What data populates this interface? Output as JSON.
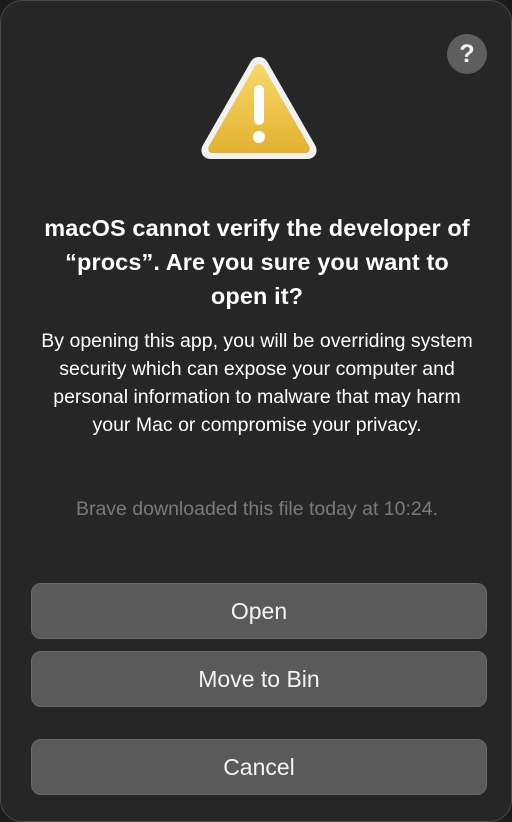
{
  "dialog": {
    "help_icon": "?",
    "warning_icon": "warning-triangle",
    "title": "macOS cannot verify the developer of “procs”. Are you sure you want to open it?",
    "message": "By opening this app, you will be overriding system security which can expose your computer and personal information to malware that may harm your Mac or compromise your privacy.",
    "download_info": "Brave downloaded this file today at 10:24.",
    "buttons": {
      "open": "Open",
      "move_to_bin": "Move to Bin",
      "cancel": "Cancel"
    },
    "colors": {
      "background": "#262626",
      "button": "#5a5a5a",
      "warning_yellow": "#f2c94c",
      "muted_text": "#7a7a7a"
    }
  }
}
